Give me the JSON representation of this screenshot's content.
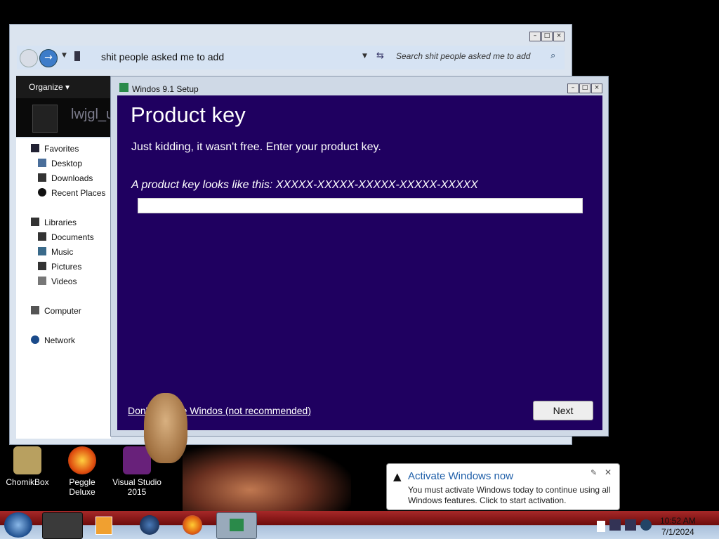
{
  "desktop": {
    "icons": [
      {
        "label": "ChomikBox"
      },
      {
        "label": "Peggle Deluxe"
      },
      {
        "label": "Visual Studio 2015"
      }
    ]
  },
  "explorer": {
    "path": "shit people asked me to add",
    "search_placeholder": "Search shit people asked me to add",
    "organize_label": "Organize",
    "preview_name": "lwjgl_u",
    "nav": {
      "favorites": "Favorites",
      "desktop": "Desktop",
      "downloads": "Downloads",
      "recent": "Recent Places",
      "libraries": "Libraries",
      "documents": "Documents",
      "music": "Music",
      "pictures": "Pictures",
      "videos": "Videos",
      "computer": "Computer",
      "network": "Network"
    }
  },
  "setup": {
    "title": "Windos 9.1 Setup",
    "heading": "Product key",
    "subtitle": "Just kidding, it wasn't free. Enter your product key.",
    "example": "A product key looks like this: XXXXX-XXXXX-XXXXX-XXXXX-XXXXX",
    "input_value": "",
    "skip_link": "Don't activate Windos (not recommended)",
    "next_label": "Next"
  },
  "toast": {
    "title": "Activate Windows now",
    "body": "You must activate Windows today to continue using all Windows features. Click to start activation."
  },
  "clock": {
    "time": "10:52 AM",
    "date": "7/1/2024"
  },
  "colors": {
    "setup_bg": "#1f0060",
    "toast_title": "#1e5ea8"
  }
}
